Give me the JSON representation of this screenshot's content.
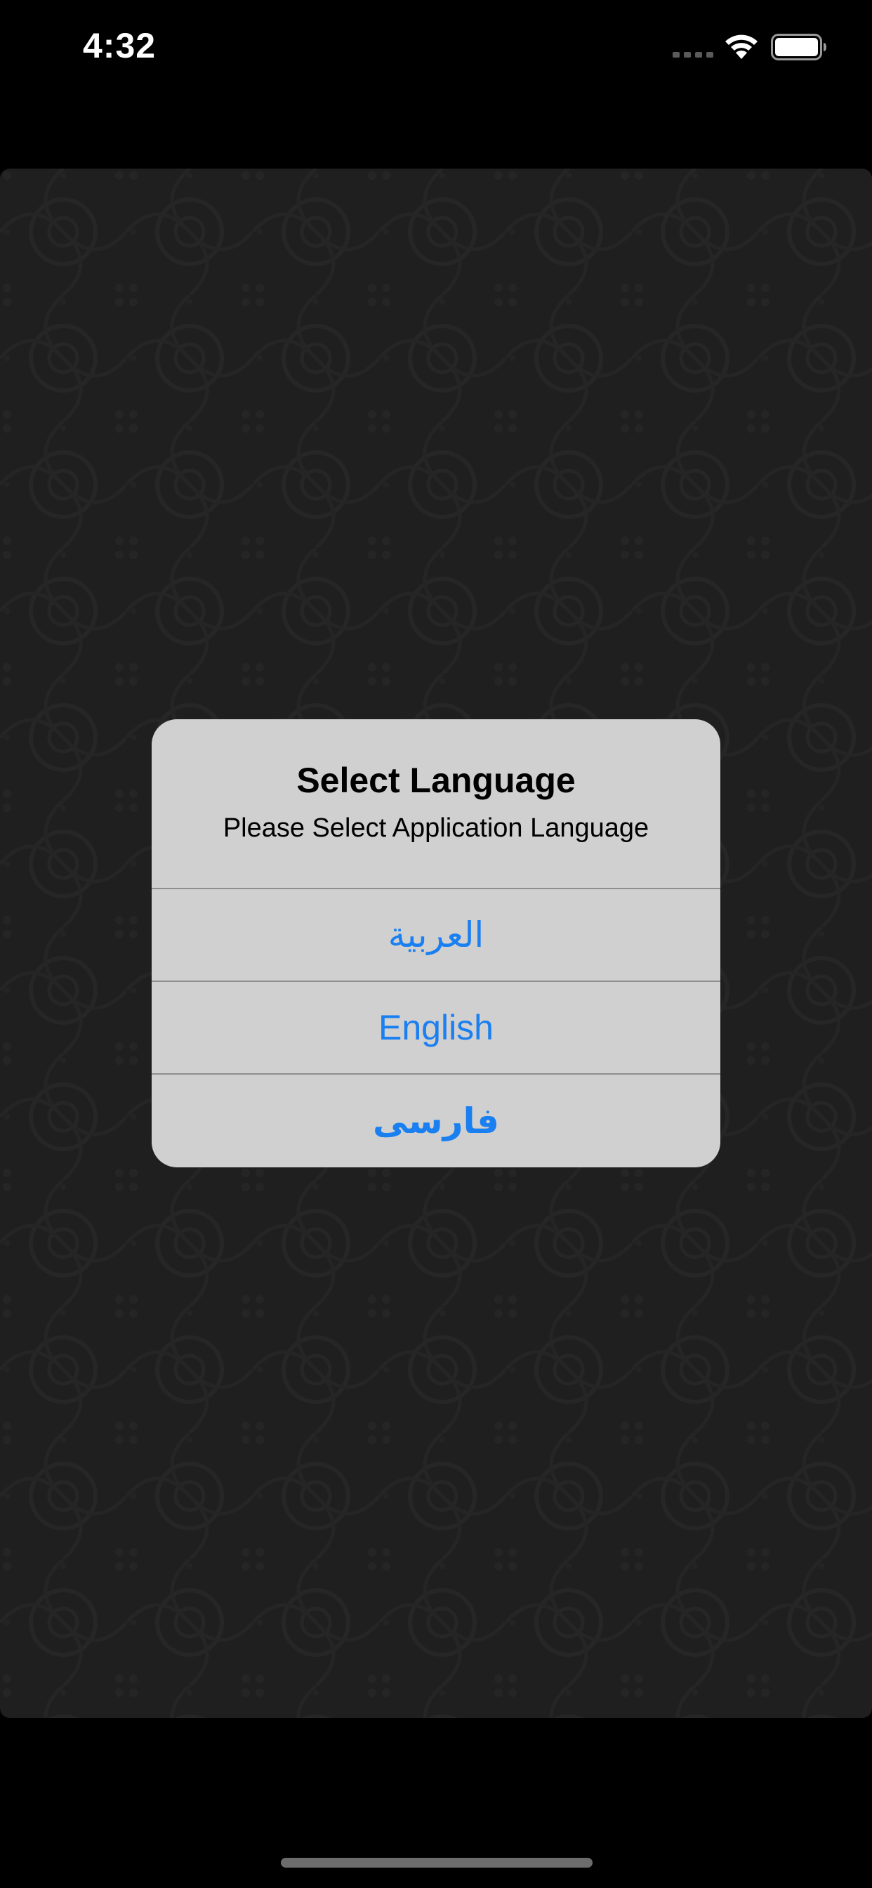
{
  "status_bar": {
    "time": "4:32"
  },
  "icons": {
    "signal": "cellular-signal-icon",
    "wifi": "wifi-icon",
    "battery": "battery-icon"
  },
  "alert": {
    "title": "Select Language",
    "message": "Please Select Application Language",
    "buttons": [
      {
        "label": "العربية"
      },
      {
        "label": "English"
      },
      {
        "label": "فارسی"
      }
    ]
  },
  "colors": {
    "accent": "#1a7ff0",
    "alert_background": "#d0d0d0",
    "content_background": "#1f1f1f"
  }
}
